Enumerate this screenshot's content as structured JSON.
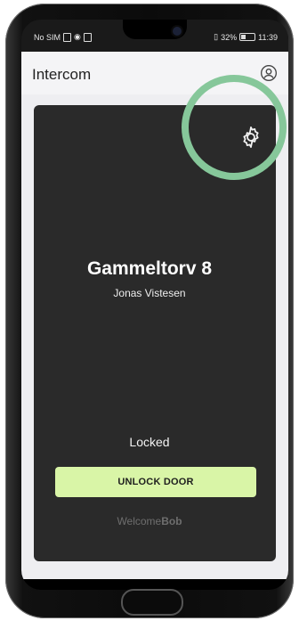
{
  "status_bar": {
    "carrier": "No SIM",
    "battery": "32%",
    "time": "11:39"
  },
  "app": {
    "title": "Intercom"
  },
  "door_card": {
    "location_name": "Gammeltorv 8",
    "resident_name": "Jonas Vistesen",
    "lock_state": "Locked",
    "unlock_label": "UNLOCK DOOR",
    "brand_light": "Welcome",
    "brand_bold": "Bob"
  },
  "icons": {
    "account": "account-circle-icon",
    "settings": "gear-icon",
    "back": "back-triangle-icon",
    "home": "home-circle-icon",
    "recent": "recent-square-icon"
  },
  "colors": {
    "unlock_button": "#d9f5a7",
    "highlight_ring": "#86c79a",
    "card_bg": "#2a2a2a"
  }
}
